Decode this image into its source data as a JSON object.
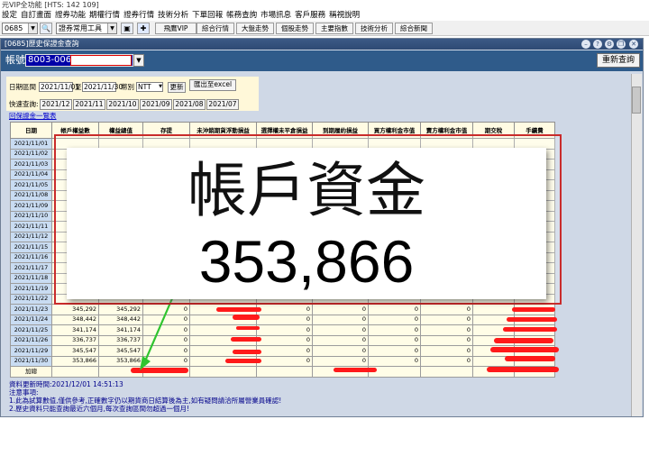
{
  "app": {
    "title": "元VIP全功能 [HTS: 142 109]"
  },
  "menu": [
    "設定",
    "自訂畫面",
    "證券功能",
    "期權行情",
    "證券行情",
    "技術分析",
    "下單回報",
    "帳務查詢",
    "市場訊息",
    "客戶服務",
    "稱視說明"
  ],
  "toolbar": {
    "symbol": "0685",
    "tool_combo": "證券常用工具",
    "buttons": [
      "飛鷹VIP",
      "綜合行情",
      "大盤走勢",
      "個股走勢",
      "主要指數",
      "技術分析",
      "綜合新聞"
    ]
  },
  "window": {
    "title": "[0685]歷史保證金查詢"
  },
  "account": {
    "label": "帳號",
    "value": "8003-0066"
  },
  "refresh_label": "重新查詢",
  "query": {
    "date_range_label": "日期區間",
    "start": "2021/11/01",
    "to": "至",
    "end": "2021/11/30",
    "currency_label": "幣別",
    "currency": "NTT",
    "update_label": "更新",
    "export_label": "匯出至excel",
    "quick_label": "快速查詢:",
    "months": [
      "2021/12",
      "2021/11",
      "2021/10",
      "2021/09",
      "2021/08",
      "2021/07"
    ],
    "back_link": "回保證金一覽表"
  },
  "table": {
    "headers": [
      "日期",
      "帳戶權益數",
      "權益總值",
      "存提",
      "未沖銷期貨浮動損益",
      "選擇權未平倉損益",
      "到期履約損益",
      "買方權利金市值",
      "賣方權利金市值",
      "期交稅",
      "手續費"
    ],
    "rows": [
      [
        "2021/11/01",
        "",
        "",
        "",
        "",
        "",
        "",
        "",
        "",
        "",
        ""
      ],
      [
        "2021/11/02",
        "",
        "",
        "",
        "",
        "",
        "",
        "",
        "",
        "",
        ""
      ],
      [
        "2021/11/03",
        "",
        "",
        "",
        "",
        "",
        "",
        "",
        "",
        "",
        ""
      ],
      [
        "2021/11/04",
        "",
        "",
        "",
        "",
        "",
        "",
        "",
        "",
        "",
        ""
      ],
      [
        "2021/11/05",
        "",
        "",
        "",
        "",
        "",
        "",
        "",
        "",
        "",
        ""
      ],
      [
        "2021/11/08",
        "",
        "",
        "",
        "",
        "",
        "",
        "",
        "",
        "",
        ""
      ],
      [
        "2021/11/09",
        "",
        "",
        "",
        "",
        "",
        "",
        "",
        "",
        "",
        ""
      ],
      [
        "2021/11/10",
        "",
        "",
        "",
        "",
        "",
        "",
        "",
        "",
        "",
        ""
      ],
      [
        "2021/11/11",
        "",
        "",
        "",
        "",
        "",
        "",
        "",
        "",
        "",
        ""
      ],
      [
        "2021/11/12",
        "",
        "",
        "",
        "",
        "",
        "",
        "",
        "",
        "",
        ""
      ],
      [
        "2021/11/15",
        "",
        "",
        "",
        "",
        "",
        "",
        "",
        "",
        "",
        ""
      ],
      [
        "2021/11/16",
        "",
        "",
        "",
        "",
        "",
        "",
        "",
        "",
        "",
        ""
      ],
      [
        "2021/11/17",
        "",
        "",
        "",
        "",
        "",
        "",
        "",
        "",
        "",
        ""
      ],
      [
        "2021/11/18",
        "",
        "",
        "",
        "",
        "",
        "",
        "",
        "",
        "",
        ""
      ],
      [
        "2021/11/19",
        "",
        "",
        "",
        "",
        "",
        "",
        "",
        "",
        "",
        ""
      ],
      [
        "2021/11/22",
        "",
        "",
        "",
        "",
        "",
        "",
        "",
        "",
        "",
        ""
      ],
      [
        "2021/11/23",
        "345,292",
        "345,292",
        "0",
        "",
        "0",
        "0",
        "0",
        "0",
        "",
        ""
      ],
      [
        "2021/11/24",
        "348,442",
        "348,442",
        "0",
        "",
        "0",
        "0",
        "0",
        "0",
        "",
        ""
      ],
      [
        "2021/11/25",
        "341,174",
        "341,174",
        "0",
        "",
        "0",
        "0",
        "0",
        "0",
        "",
        ""
      ],
      [
        "2021/11/26",
        "336,737",
        "336,737",
        "0",
        "",
        "0",
        "0",
        "0",
        "0",
        "",
        ""
      ],
      [
        "2021/11/29",
        "345,547",
        "345,547",
        "0",
        "",
        "0",
        "0",
        "0",
        "0",
        "",
        ""
      ],
      [
        "2021/11/30",
        "353,866",
        "353,866",
        "0",
        "",
        "0",
        "0",
        "0",
        "0",
        "",
        ""
      ]
    ],
    "sum_label": "加總"
  },
  "notes": [
    "資料更新時間:2021/12/01 14:51:13",
    "注意事項:",
    "1.此為試算數值,僅供參考,正確數字仍以期貨商日結算後為主,如有疑問請洽所屬營業員確認!",
    "2.歷史資料只能查詢最近六個月,每次查詢區間勿超過一個月!"
  ],
  "callout": {
    "label": "帳戶資金",
    "value": "353,866"
  },
  "colors": {
    "highlight_red": "#ff1a1a",
    "arrow_green": "#2fc42f",
    "frame_red": "#c92b2b"
  }
}
